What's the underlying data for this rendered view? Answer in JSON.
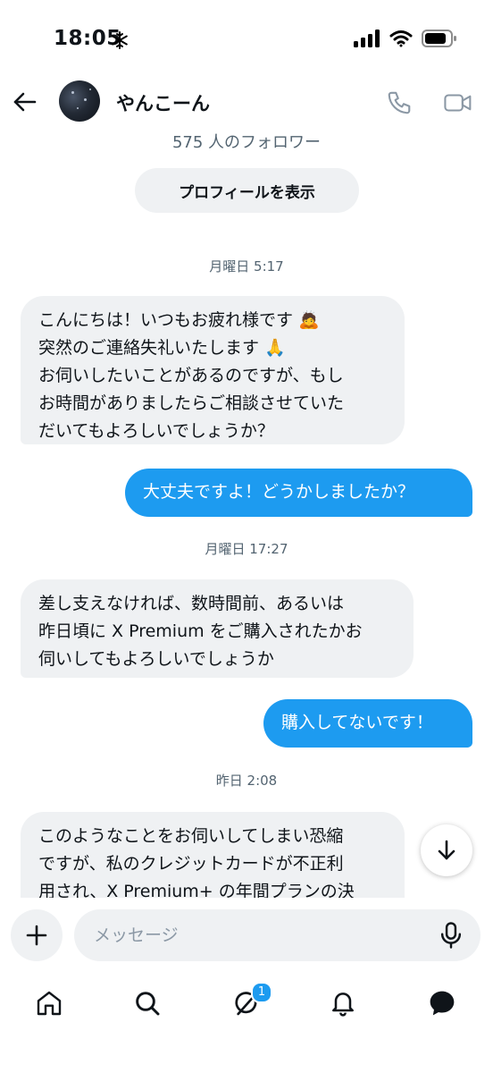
{
  "status_bar": {
    "time": "18:05"
  },
  "header": {
    "contact_name": "やんこーん",
    "followers": "575 人のフォロワー",
    "profile_button": "プロフィールを表示"
  },
  "messages": [
    {
      "type": "timestamp",
      "text": "月曜日 5:17"
    },
    {
      "type": "incoming",
      "lines": [
        "こんにちは！いつもお疲れ様です 🙇",
        "突然のご連絡失礼いたします 🙏",
        "お伺いしたいことがあるのですが、もし",
        "お時間がありましたらご相談させていた",
        "だいてもよろしいでしょうか？"
      ]
    },
    {
      "type": "outgoing",
      "text": "大丈夫ですよ！どうかしましたか？"
    },
    {
      "type": "timestamp",
      "text": "月曜日 17:27"
    },
    {
      "type": "incoming",
      "lines": [
        "差し支えなければ、数時間前、あるいは",
        "昨日頃に X Premium をご購入されたかお",
        "伺いしてもよろしいでしょうか"
      ]
    },
    {
      "type": "outgoing",
      "text": "購入してないです！"
    },
    {
      "type": "timestamp",
      "text": "昨日 2:08"
    },
    {
      "type": "incoming",
      "lines": [
        "このようなことをお伺いしてしまい恐縮",
        "ですが、私のクレジットカードが不正利",
        "用され、X Premium+ の年間プランの決"
      ]
    }
  ],
  "composer": {
    "placeholder": "メッセージ"
  },
  "nav": {
    "messages_badge": "1"
  },
  "colors": {
    "accent": "#1d9bf0",
    "incoming_bubble": "#eff1f3",
    "secondary_text": "#536471"
  },
  "icons": [
    "back-arrow-icon",
    "phone-icon",
    "video-camera-icon",
    "arrow-down-icon",
    "plus-icon",
    "microphone-icon",
    "home-icon",
    "search-icon",
    "grok-icon",
    "bell-icon",
    "messages-icon",
    "snowflake-icon",
    "signal-icon",
    "wifi-icon",
    "battery-icon"
  ]
}
